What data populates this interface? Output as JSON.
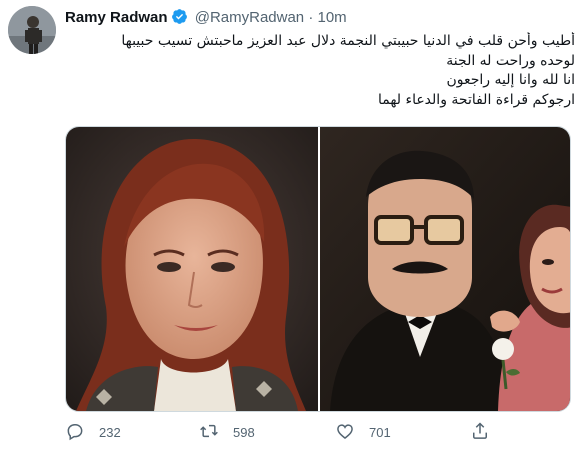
{
  "tweet": {
    "author_name": "Ramy Radwan",
    "handle": "@RamyRadwan",
    "separator": "·",
    "time": "10m",
    "lines": [
      "أطيب وأحن قلب في الدنيا حبيبتي النجمة دلال عبد العزيز ماحبتش تسيب حبيبها",
      "لوحده وراحت له الجنة",
      "انا لله وانا إليه راجعون",
      "ارجوكم قراءة الفاتحة والدعاء لهما"
    ]
  },
  "actions": {
    "reply_count": "232",
    "retweet_count": "598",
    "like_count": "701"
  },
  "icons": {
    "verified": "verified-badge-icon",
    "reply": "reply-icon",
    "retweet": "retweet-icon",
    "like": "heart-icon",
    "share": "share-icon"
  },
  "colors": {
    "verified": "#1d9bf0",
    "secondary_text": "#536471",
    "border": "#cfd9de"
  }
}
